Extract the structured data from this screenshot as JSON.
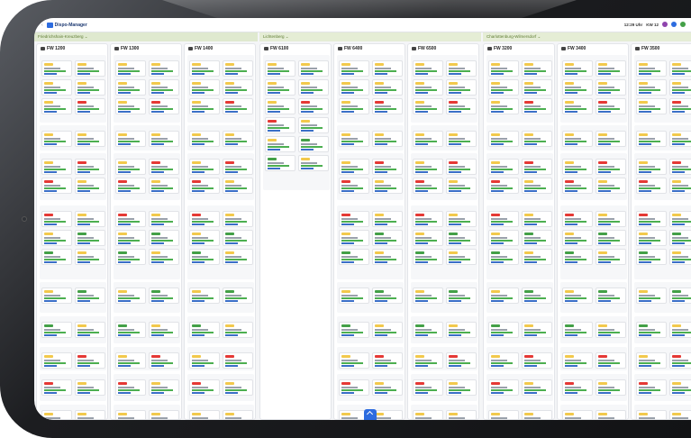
{
  "app": {
    "title": "Dispo-Manager",
    "back_label": "‹"
  },
  "topbar": {
    "time": "12:29 Uhr",
    "week": "KW 12",
    "avatar_colors": [
      "#8e44ad",
      "#2d6cdf",
      "#43a047"
    ]
  },
  "districts": [
    {
      "label": "Friedrichshain-Kreuzberg ⌄"
    },
    {
      "label": "Lichtenberg ⌄"
    },
    {
      "label": "Charlottenburg-Wilmersdorf ⌄"
    }
  ],
  "columns": [
    {
      "title": "FW 1200"
    },
    {
      "title": "FW 1300"
    },
    {
      "title": "FW 1400"
    },
    {
      "title": "FW 6100"
    },
    {
      "title": "FW 6400"
    },
    {
      "title": "FW 6500"
    },
    {
      "title": "FW 3200"
    },
    {
      "title": "FW 3400"
    },
    {
      "title": "FW 3500"
    }
  ],
  "colors": {
    "accent": "#2d6cdf",
    "green": "#43a047",
    "yellow": "#f2c94c",
    "red": "#e53935",
    "district_bg": "#dfe9cf"
  }
}
